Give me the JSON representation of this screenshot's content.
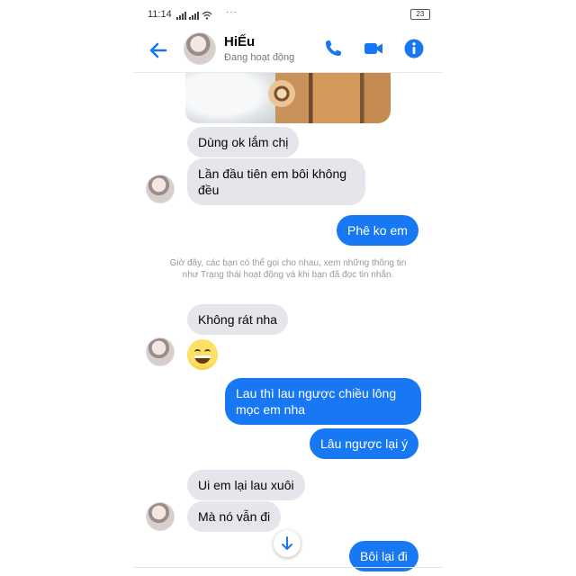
{
  "status_bar": {
    "time": "11:14",
    "dots": "···",
    "battery": "23"
  },
  "header": {
    "name": "HiẾu",
    "status": "Đang hoạt động",
    "icons": [
      "back-arrow-icon",
      "phone-icon",
      "video-camera-icon",
      "info-icon"
    ],
    "accent": "#1877f2"
  },
  "messages": [
    {
      "side": "in",
      "text": "Dùng ok lắm chị"
    },
    {
      "side": "in",
      "text": "Lần đầu tiên em bôi không đều"
    },
    {
      "side": "out",
      "text": "Phê ko em"
    },
    {
      "side": "in",
      "text": "Không rát nha"
    },
    {
      "side": "in",
      "emoji": "grinning-face-icon"
    },
    {
      "side": "out",
      "text": "Lau thì lau ngược chiều lông mọc em nha"
    },
    {
      "side": "out",
      "text": "Lâu ngược lại ý"
    },
    {
      "side": "in",
      "text": "Ui em lại lau xuôi"
    },
    {
      "side": "in",
      "text": "Mà nó vẫn đi"
    },
    {
      "side": "out",
      "text": "Bôi lại đi"
    }
  ],
  "notice": "Giờ đây, các bạn có thể gọi cho nhau, xem những thông tin như Trạng thái hoạt động và khi bạn đã đọc tin nhắn.",
  "colors": {
    "incoming_bubble": "#e4e6eb",
    "outgoing_bubble": "#1877f2"
  }
}
